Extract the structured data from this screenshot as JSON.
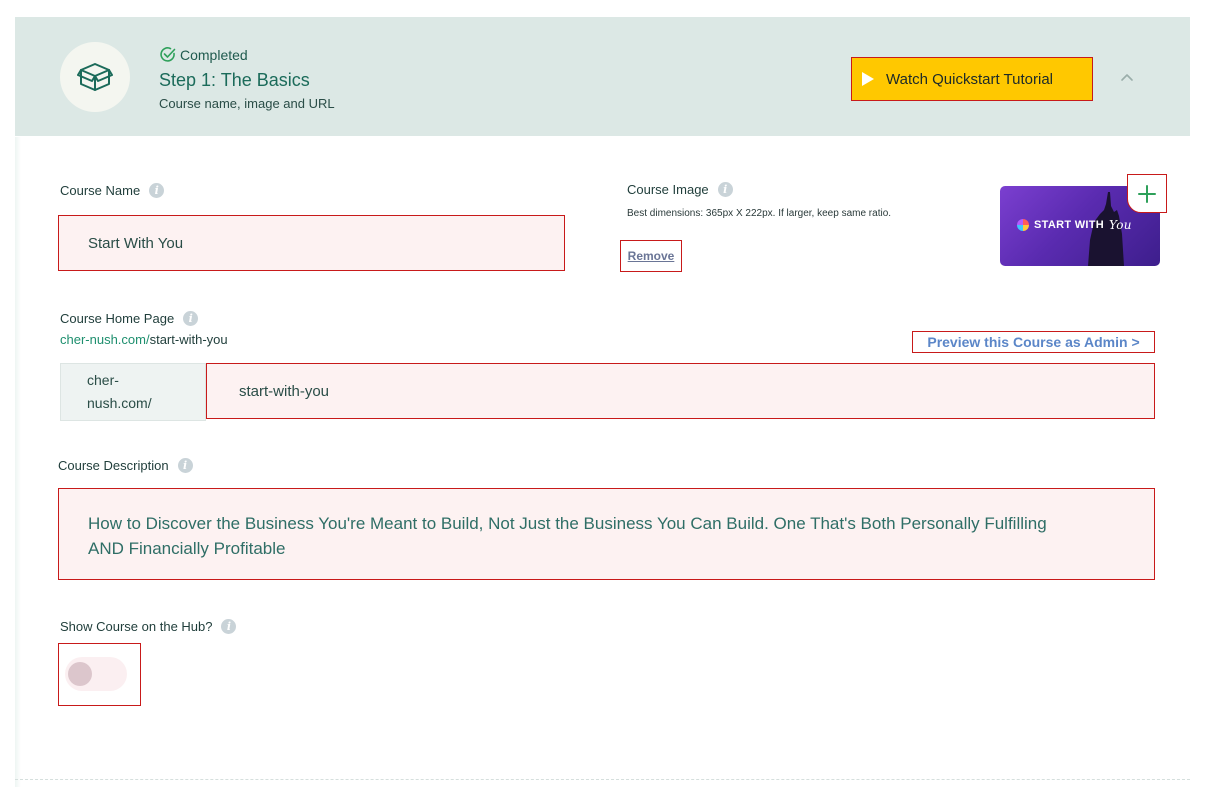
{
  "header": {
    "status": "Completed",
    "title": "Step 1: The Basics",
    "subtitle": "Course name, image and URL",
    "tutorial_button": "Watch Quickstart Tutorial"
  },
  "course_name": {
    "label": "Course Name",
    "value": "Start With You"
  },
  "course_image": {
    "label": "Course Image",
    "hint": "Best dimensions: 365px X 222px. If larger, keep same ratio.",
    "remove_label": "Remove",
    "thumbnail_text": "START WITH",
    "thumbnail_script": "You"
  },
  "home_page": {
    "label": "Course Home Page",
    "url_domain": "cher-nush.com/",
    "url_slug": "start-with-you",
    "preview_link": "Preview this Course as Admin >",
    "prefix_line1": "cher-",
    "prefix_line2": "nush.com/",
    "input_value": "start-with-you"
  },
  "description": {
    "label": "Course Description",
    "value": "How to Discover the Business You're Meant to Build, Not Just the Business You Can Build. One That's Both Personally Fulfilling AND Financially Profitable"
  },
  "hub": {
    "label": "Show Course on the Hub?",
    "enabled": false
  },
  "info_glyph": "i",
  "colors": {
    "header_bg": "#dce8e5",
    "accent_yellow": "#ffc800",
    "accent_green": "#1b6b5a",
    "highlight_border": "#c81a1a"
  }
}
